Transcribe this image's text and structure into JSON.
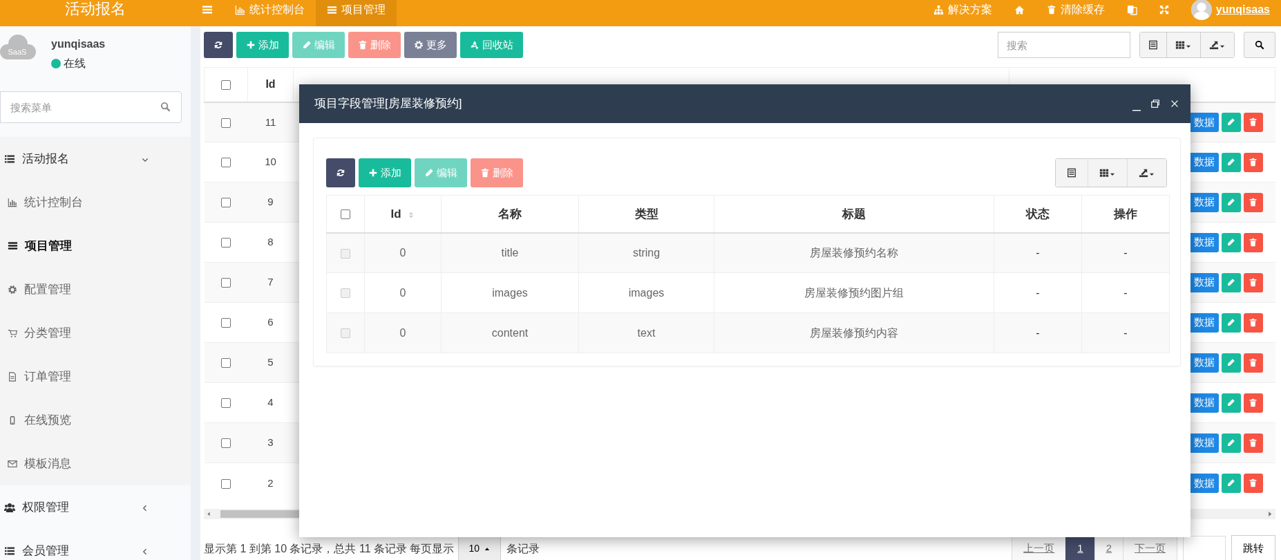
{
  "navbar": {
    "logo": "活动报名",
    "tabs": [
      {
        "label": "统计控制台",
        "selected": false
      },
      {
        "label": "项目管理",
        "selected": true
      }
    ],
    "links": [
      {
        "label": "解决方案"
      },
      {
        "label": "清除缓存"
      }
    ],
    "user": "yunqisaas"
  },
  "sidebar": {
    "user": {
      "avatar_text": "SaaS",
      "name": "yunqisaas",
      "status": "在线",
      "online": true
    },
    "search": {
      "placeholder": "搜索菜单"
    },
    "menu": [
      {
        "label": "活动报名",
        "expanded": true,
        "children": [
          {
            "label": "统计控制台",
            "selected": false
          },
          {
            "label": "项目管理",
            "selected": true
          },
          {
            "label": "配置管理",
            "selected": false
          },
          {
            "label": "分类管理",
            "selected": false
          },
          {
            "label": "订单管理",
            "selected": false
          },
          {
            "label": "在线预览",
            "selected": false
          },
          {
            "label": "模板消息",
            "selected": false
          }
        ]
      },
      {
        "label": "权限管理",
        "expanded": false
      },
      {
        "label": "会员管理",
        "expanded": false
      }
    ]
  },
  "toolbar": {
    "buttons": [
      {
        "kind": "refresh",
        "disabled": false
      },
      {
        "kind": "add",
        "label": "添加",
        "disabled": false
      },
      {
        "kind": "edit",
        "label": "编辑",
        "disabled": true
      },
      {
        "kind": "delete",
        "label": "删除",
        "disabled": true
      },
      {
        "kind": "more",
        "label": "更多",
        "disabled": false
      },
      {
        "kind": "recycle",
        "label": "回收站",
        "disabled": false
      }
    ],
    "search": {
      "placeholder": "搜索"
    }
  },
  "table": {
    "select_all_checked": false,
    "columns": [
      "Id"
    ],
    "rows": [
      {
        "id": "11",
        "checked": false,
        "action": "数据"
      },
      {
        "id": "10",
        "checked": false,
        "action": "数据"
      },
      {
        "id": "9",
        "checked": false,
        "action": "数据"
      },
      {
        "id": "8",
        "checked": false,
        "action": "数据"
      },
      {
        "id": "7",
        "checked": false,
        "action": "数据"
      },
      {
        "id": "6",
        "checked": false,
        "action": "数据"
      },
      {
        "id": "5",
        "checked": false,
        "action": "数据"
      },
      {
        "id": "4",
        "checked": false,
        "action": "数据"
      },
      {
        "id": "3",
        "checked": false,
        "action": "数据"
      },
      {
        "id": "2",
        "checked": false,
        "action": "数据"
      }
    ]
  },
  "pagination": {
    "summary": "显示第 1 到第 10 条记录，总共 11 条记录 每页显示",
    "page_size": "10",
    "suffix": "条记录",
    "prev": "上一页",
    "pages": [
      {
        "label": "1",
        "selected": true
      },
      {
        "label": "2",
        "selected": false
      }
    ],
    "next": "下一页",
    "jump": "跳转"
  },
  "modal": {
    "title": "项目字段管理[房屋装修预约]",
    "buttons": [
      {
        "kind": "refresh",
        "disabled": false
      },
      {
        "kind": "add",
        "label": "添加",
        "disabled": false
      },
      {
        "kind": "edit",
        "label": "编辑",
        "disabled": true
      },
      {
        "kind": "delete",
        "label": "删除",
        "disabled": true
      }
    ],
    "select_all_checked": false,
    "columns": [
      "Id",
      "名称",
      "类型",
      "标题",
      "状态",
      "操作"
    ],
    "rows": [
      {
        "checked": false,
        "disabled": true,
        "cells": [
          "0",
          "title",
          "string",
          "房屋装修预约名称",
          "-",
          "-"
        ]
      },
      {
        "checked": false,
        "disabled": true,
        "cells": [
          "0",
          "images",
          "images",
          "房屋装修预约图片组",
          "-",
          "-"
        ]
      },
      {
        "checked": false,
        "disabled": true,
        "cells": [
          "0",
          "content",
          "text",
          "房屋装修预约内容",
          "-",
          "-"
        ]
      }
    ]
  }
}
